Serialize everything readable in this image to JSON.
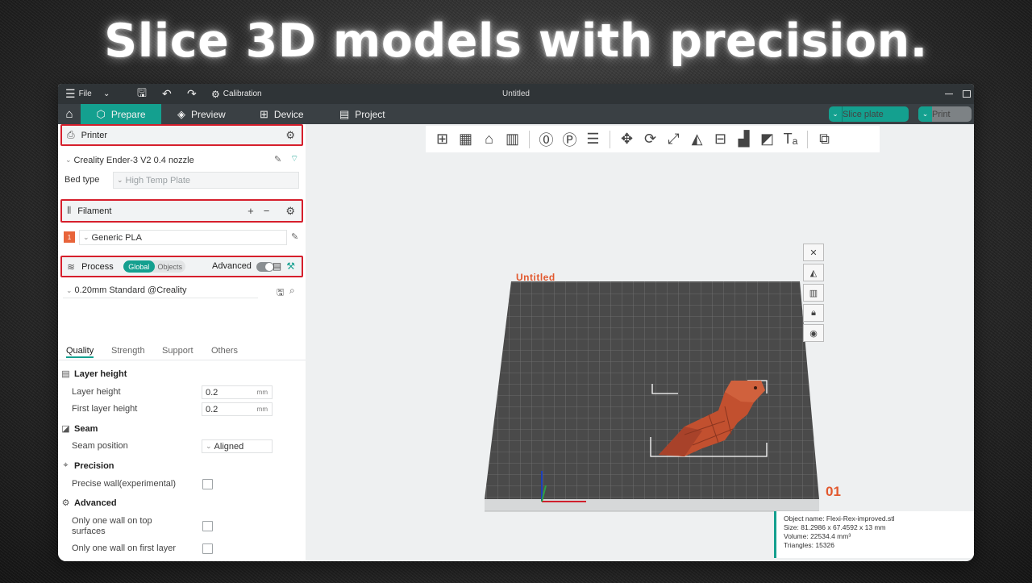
{
  "headline": "Slice 3D models with precision.",
  "titlebar": {
    "file_label": "File",
    "calibration_label": "Calibration",
    "window_title": "Untitled"
  },
  "tabs": [
    {
      "label": "Prepare",
      "active": true
    },
    {
      "label": "Preview"
    },
    {
      "label": "Device"
    },
    {
      "label": "Project"
    }
  ],
  "actions": {
    "slice_label": "Slice plate",
    "print_label": "Print"
  },
  "printer": {
    "section_label": "Printer",
    "name": "Creality Ender-3 V2 0.4 nozzle",
    "bed_type_label": "Bed type",
    "bed_type_value": "High Temp Plate"
  },
  "filament": {
    "section_label": "Filament",
    "slot_number": "1",
    "slot_color": "#e8643a",
    "name": "Generic PLA"
  },
  "process": {
    "section_label": "Process",
    "scope_global": "Global",
    "scope_objects": "Objects",
    "advanced_label": "Advanced",
    "preset": "0.20mm Standard @Creality"
  },
  "settings_tabs": [
    "Quality",
    "Strength",
    "Support",
    "Others"
  ],
  "quality": {
    "layer_height_group": "Layer height",
    "layer_height_label": "Layer height",
    "layer_height_value": "0.2",
    "first_layer_height_label": "First layer height",
    "first_layer_height_value": "0.2",
    "unit_mm": "mm",
    "seam_group": "Seam",
    "seam_position_label": "Seam position",
    "seam_position_value": "Aligned",
    "precision_group": "Precision",
    "precise_wall_label": "Precise wall(experimental)",
    "advanced_group": "Advanced",
    "one_wall_top_label": "Only one wall on top surfaces",
    "one_wall_first_label": "Only one wall on first layer"
  },
  "plate": {
    "title": "Untitled",
    "number": "01"
  },
  "object_info": {
    "name_line": "Object name: Flexi-Rex-improved.stl",
    "size_line": "Size: 81.2986 x 67.4592 x 13 mm",
    "volume_line": "Volume: 22534.4 mm³",
    "triangles_line": "Triangles: 15326"
  },
  "colors": {
    "accent": "#14a08f",
    "highlight": "#d61f2c",
    "model": "#c2502f"
  }
}
